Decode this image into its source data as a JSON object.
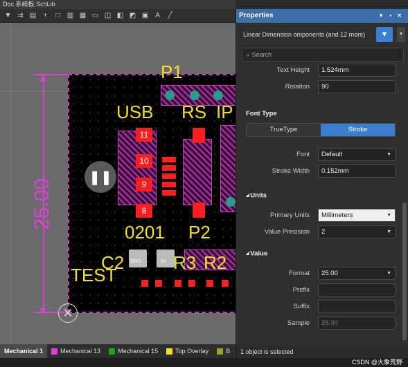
{
  "doc_tab": "Doc 系统板.SchLib",
  "toolbar_icons": [
    "filter-icon",
    "route-icon",
    "layers-icon",
    "plus-icon",
    "square-icon",
    "chart-icon",
    "grid-icon",
    "align-icon",
    "chip-icon",
    "component-icon",
    "region-icon",
    "image-icon",
    "text-icon",
    "line-icon"
  ],
  "canvas": {
    "labels": {
      "p1": "P1",
      "usb": "USB",
      "rs": "RS",
      "ip": "IP",
      "code": "0201",
      "p2": "P2",
      "test": "TEST",
      "c2": "C2",
      "r3": "R3",
      "r2": "R2"
    },
    "pads": [
      "11",
      "10",
      "9",
      "8"
    ],
    "teal_labels": [
      "GND",
      "5V"
    ],
    "dimension_text": "25.00"
  },
  "layers": [
    {
      "label": "Mechanical 1",
      "color": "#ffffff",
      "active": true
    },
    {
      "label": "Mechanical 13",
      "color": "#e33de0"
    },
    {
      "label": "Mechanical 15",
      "color": "#18a818"
    },
    {
      "label": "Top Overlay",
      "color": "#f0e028"
    },
    {
      "label": "B",
      "color": "#a0a020"
    }
  ],
  "panel": {
    "title": "Properties",
    "filter_text": "Linear Dimension   omponents (and 12 more)",
    "search_placeholder": "Search",
    "text_height_label": "Text Height",
    "text_height_value": "1.524mm",
    "rotation_label": "Rotation",
    "rotation_value": "90",
    "font_type_section": "Font Type",
    "truetype_label": "TrueType",
    "stroke_label": "Stroke",
    "font_label": "Font",
    "font_value": "Default",
    "stroke_width_label": "Stroke Width",
    "stroke_width_value": "0.152mm",
    "units_section": "Units",
    "primary_units_label": "Primary Units",
    "primary_units_value": "Millimeters",
    "value_precision_label": "Value Precision",
    "value_precision_value": "2",
    "value_section": "Value",
    "format_label": "Format",
    "format_value": "25.00",
    "prefix_label": "Prefix",
    "suffix_label": "Suffix",
    "sample_label": "Sample",
    "sample_value": "25.00",
    "status": "1 object is selected"
  },
  "watermark": "CSDN @大象荒野"
}
